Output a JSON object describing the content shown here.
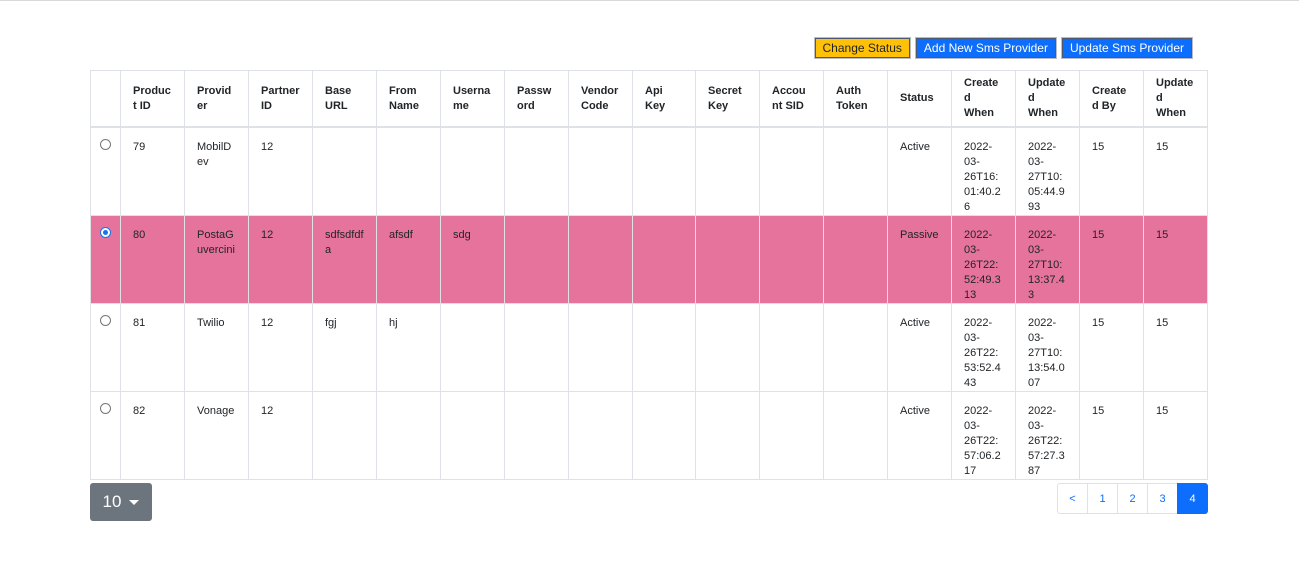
{
  "toolbar": {
    "change_status": "Change Status",
    "add_provider": "Add New Sms Provider",
    "update_provider": "Update Sms Provider"
  },
  "table": {
    "headers": [
      "",
      "Product ID",
      "Provider",
      "Partner ID",
      "Base URL",
      "From Name",
      "Username",
      "Password",
      "Vendor Code",
      "Api Key",
      "Secret Key",
      "Account SID",
      "Auth Token",
      "Status",
      "Created When",
      "Updated When",
      "Created By",
      "Updated When"
    ],
    "rows": [
      {
        "selected": false,
        "cells": [
          "79",
          "MobilDev",
          "12",
          "",
          "",
          "",
          "",
          "",
          "",
          "",
          "",
          "",
          "Active",
          "2022-03-26T16:01:40.26",
          "2022-03-27T10:05:44.993",
          "15",
          "15"
        ]
      },
      {
        "selected": true,
        "cells": [
          "80",
          "PostaGuvercini",
          "12",
          "sdfsdfdfa",
          "afsdf",
          "sdg",
          "",
          "",
          "",
          "",
          "",
          "",
          "Passive",
          "2022-03-26T22:52:49.313",
          "2022-03-27T10:13:37.43",
          "15",
          "15"
        ]
      },
      {
        "selected": false,
        "cells": [
          "81",
          "Twilio",
          "12",
          "fgj",
          "hj",
          "",
          "",
          "",
          "",
          "",
          "",
          "",
          "Active",
          "2022-03-26T22:53:52.443",
          "2022-03-27T10:13:54.007",
          "15",
          "15"
        ]
      },
      {
        "selected": false,
        "cells": [
          "82",
          "Vonage",
          "12",
          "",
          "",
          "",
          "",
          "",
          "",
          "",
          "",
          "",
          "Active",
          "2022-03-26T22:57:06.217",
          "2022-03-26T22:57:27.387",
          "15",
          "15"
        ]
      }
    ]
  },
  "page_size": "10",
  "pagination": {
    "prev": "<",
    "pages": [
      "1",
      "2",
      "3",
      "4"
    ],
    "active": "4"
  },
  "colors": {
    "selected_row": "#e5739c",
    "primary": "#0d6efd",
    "warning": "#ffc107",
    "secondary": "#6c757d"
  }
}
